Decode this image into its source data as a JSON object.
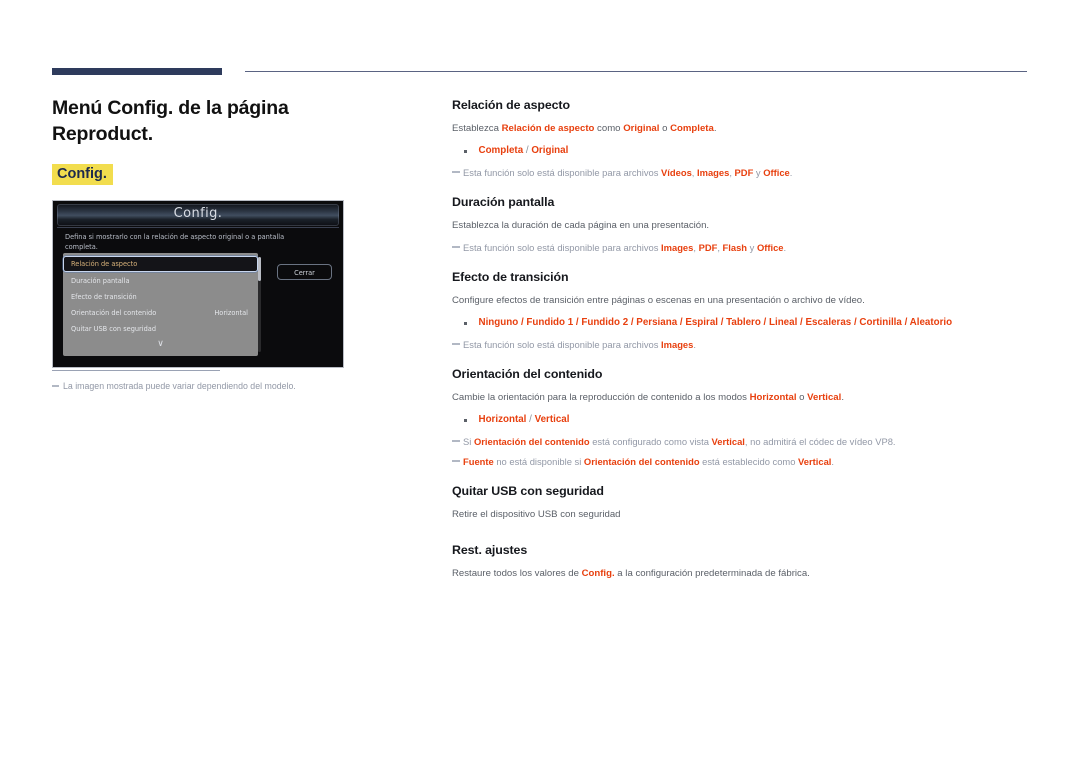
{
  "page": {
    "title": "Menú Config. de la página Reproduct.",
    "section_chip": "Config."
  },
  "tv_dialog": {
    "title": "Config.",
    "description": "Defina si mostrarlo con la relación de aspecto original o a pantalla completa.",
    "close_button": "Cerrar",
    "chevron": "∨",
    "rows": [
      {
        "label": "Relación de aspecto",
        "value": "",
        "selected": true
      },
      {
        "label": "Duración pantalla",
        "value": "",
        "selected": false
      },
      {
        "label": "Efecto de transición",
        "value": "",
        "selected": false
      },
      {
        "label": "Orientación del contenido",
        "value": "Horizontal",
        "selected": false
      },
      {
        "label": "Quitar USB con seguridad",
        "value": "",
        "selected": false
      }
    ]
  },
  "left_note": {
    "text": "La imagen mostrada puede variar dependiendo del modelo."
  },
  "sections": {
    "aspect": {
      "heading": "Relación de aspecto",
      "desc_1": "Establezca ",
      "desc_em1": "Relación de aspecto",
      "desc_2": " como ",
      "desc_em2": "Original",
      "desc_3": " o ",
      "desc_em3": "Completa",
      "desc_4": ".",
      "bullet_a": "Completa",
      "bullet_sep": " / ",
      "bullet_b": "Original",
      "note_1": "Esta función solo está disponible para archivos ",
      "note_em1": "Vídeos",
      "note_2": ", ",
      "note_em2": "Images",
      "note_3": ", ",
      "note_em3": "PDF",
      "note_4": " y ",
      "note_em4": "Office",
      "note_5": "."
    },
    "duration": {
      "heading": "Duración pantalla",
      "desc": "Establezca la duración de cada página en una presentación.",
      "note_1": "Esta función solo está disponible para archivos ",
      "note_em1": "Images",
      "note_2": ", ",
      "note_em2": "PDF",
      "note_3": ", ",
      "note_em3": "Flash",
      "note_4": " y ",
      "note_em4": "Office",
      "note_5": "."
    },
    "transition": {
      "heading": "Efecto de transición",
      "desc": "Configure efectos de transición entre páginas o escenas en una presentación o archivo de vídeo.",
      "options": "Ninguno / Fundido 1 / Fundido 2 / Persiana / Espiral / Tablero / Lineal / Escaleras / Cortinilla / Aleatorio",
      "note_1": "Esta función solo está disponible para archivos ",
      "note_em1": "Images",
      "note_2": "."
    },
    "orientation": {
      "heading": "Orientación del contenido",
      "desc_1": "Cambie la orientación para la reproducción de contenido a los modos ",
      "desc_em1": "Horizontal",
      "desc_2": " o ",
      "desc_em2": "Vertical",
      "desc_3": ".",
      "bullet_a": "Horizontal",
      "bullet_sep": " / ",
      "bullet_b": "Vertical",
      "note1_1": "Si ",
      "note1_em1": "Orientación del contenido",
      "note1_2": " está configurado como vista ",
      "note1_em2": "Vertical",
      "note1_3": ", no admitirá el códec de vídeo VP8.",
      "note2_em1": "Fuente",
      "note2_1": " no está disponible si ",
      "note2_em2": "Orientación del contenido",
      "note2_2": " está establecido como ",
      "note2_em3": "Vertical",
      "note2_3": "."
    },
    "usb": {
      "heading": "Quitar USB con seguridad",
      "desc": "Retire el dispositivo USB con seguridad"
    },
    "reset": {
      "heading": "Rest. ajustes",
      "desc_1": "Restaure todos los valores de ",
      "desc_em1": "Config.",
      "desc_2": " a la configuración predeterminada de fábrica."
    }
  },
  "colors": {
    "accent_red": "#e8400f",
    "chip_yellow": "#f2dd4e",
    "rule_navy": "#2e3b5c",
    "note_grey": "#9298a6"
  }
}
